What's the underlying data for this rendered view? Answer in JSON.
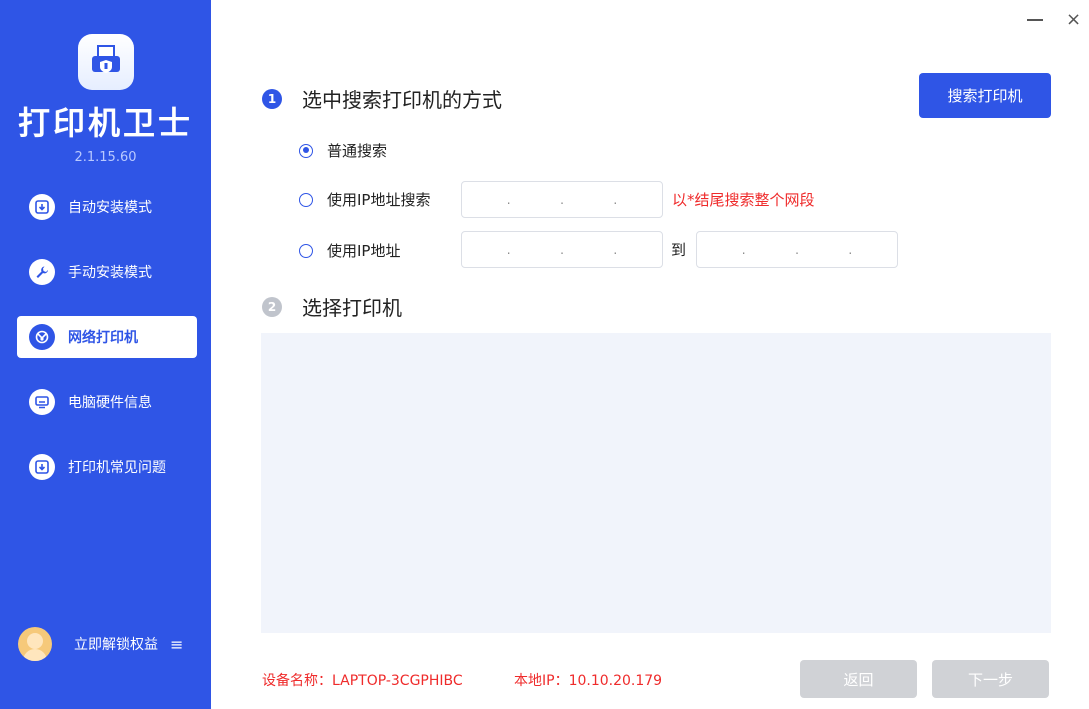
{
  "app": {
    "name": "打印机卫士",
    "version": "2.1.15.60"
  },
  "sidebar": {
    "items": [
      {
        "label": "自动安装模式",
        "icon": "download-icon"
      },
      {
        "label": "手动安装模式",
        "icon": "wrench-icon"
      },
      {
        "label": "网络打印机",
        "icon": "network-icon",
        "active": true
      },
      {
        "label": "电脑硬件信息",
        "icon": "monitor-icon"
      },
      {
        "label": "打印机常见问题",
        "icon": "download-icon"
      }
    ],
    "unlock_label": "立即解锁权益",
    "menu_glyph": "≡"
  },
  "window": {
    "close_glyph": "×"
  },
  "step1": {
    "number": "1",
    "title": "选中搜索打印机的方式",
    "search_button": "搜索打印机",
    "options": [
      {
        "label": "普通搜索",
        "checked": true
      },
      {
        "label": "使用IP地址搜索",
        "checked": false
      },
      {
        "label": "使用IP地址",
        "checked": false
      }
    ],
    "ip_hint": "以*结尾搜索整个网段",
    "to_label": "到",
    "ip_dots": [
      ".",
      ".",
      "."
    ]
  },
  "step2": {
    "number": "2",
    "title": "选择打印机"
  },
  "footer": {
    "device_name": "设备名称：LAPTOP-3CGPHIBC",
    "local_ip": "本地IP：10.10.20.179",
    "back_button": "返回",
    "next_button": "下一步"
  },
  "colors": {
    "accent": "#2f55e6",
    "warning": "#ef2b2b",
    "disabled": "#d0d2d6",
    "step2_num": "#c0c4cc"
  }
}
